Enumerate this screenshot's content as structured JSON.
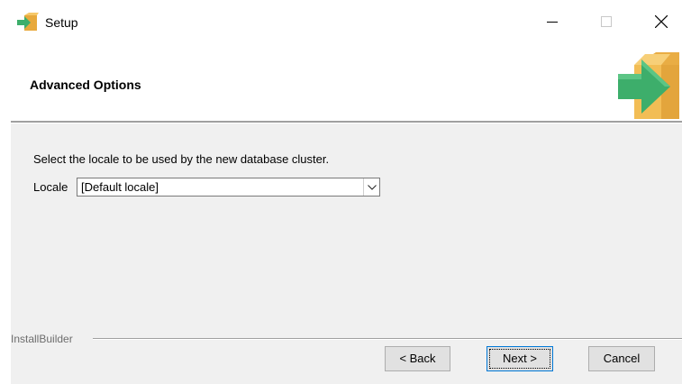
{
  "window": {
    "title": "Setup",
    "controls": {
      "minimize_icon": "minimize-icon",
      "maximize_icon": "maximize-icon",
      "close_icon": "close-icon"
    }
  },
  "header": {
    "title": "Advanced Options",
    "logo_icon": "installer-box-arrow-icon"
  },
  "body": {
    "instruction": "Select the locale to be used by the new database cluster.",
    "locale": {
      "label": "Locale",
      "selected_value": "[Default locale]"
    }
  },
  "footer": {
    "group_label": "InstallBuilder",
    "buttons": {
      "back": "< Back",
      "next": "Next >",
      "cancel": "Cancel"
    }
  },
  "colors": {
    "window_bg": "#ffffff",
    "panel_bg": "#f0f0f0",
    "button_bg": "#e1e1e1",
    "focus_border": "#0078d7",
    "logo_box": "#f0c060",
    "logo_arrow": "#3dae6b"
  }
}
